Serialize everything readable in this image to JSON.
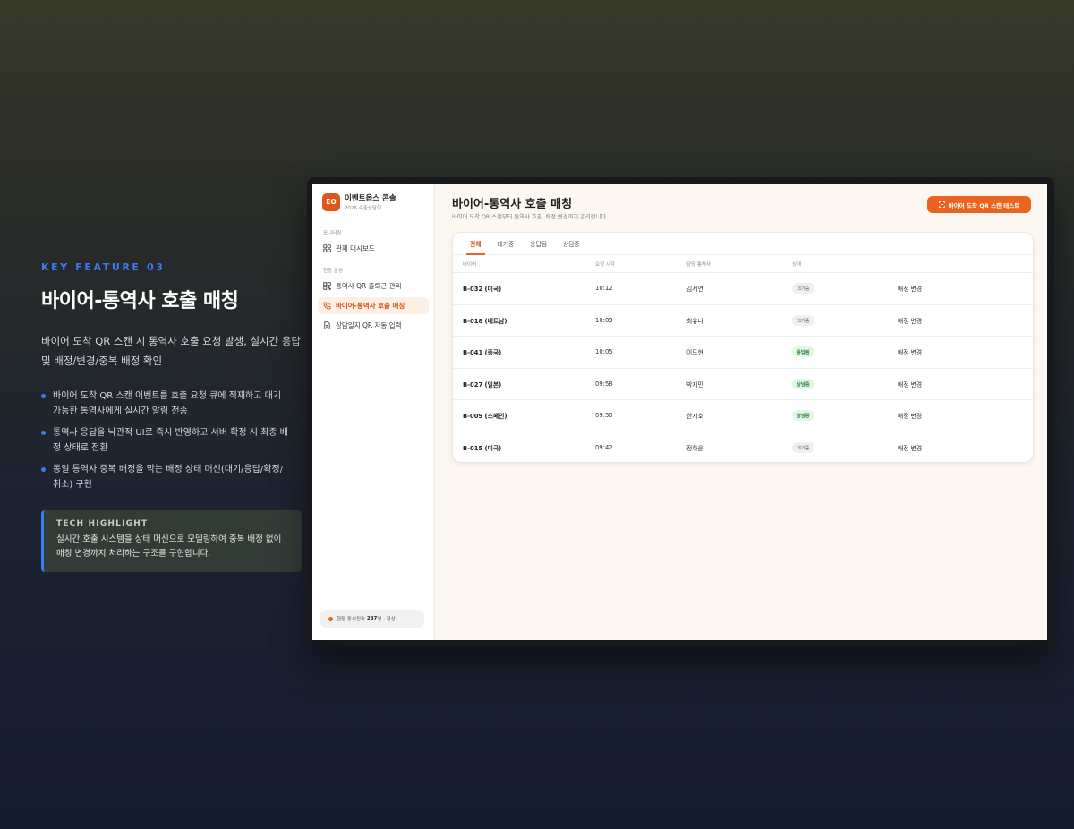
{
  "feature": {
    "eyebrow": "KEY FEATURE 03",
    "title": "바이어-통역사 호출 매칭",
    "description": "바이어 도착 QR 스캔 시 통역사 호출 요청 발생, 실시간 응답 및 배정/변경/중복 배정 확인",
    "bullets": [
      "바이어 도착 QR 스캔 이벤트를 호출 요청 큐에 적재하고 대기 가능한 통역사에게 실시간 알림 전송",
      "통역사 응답을 낙관적 UI로 즉시 반영하고 서버 확정 시 최종 배정 상태로 전환",
      "동일 통역사 중복 배정을 막는 배정 상태 머신(대기/응답/확정/취소) 구현"
    ],
    "tech_title": "TECH HIGHLIGHT",
    "tech_text": "실시간 호출 시스템을 상태 머신으로 모델링하여 중복 배정 없이 매칭 변경까지 처리하는 구조를 구현합니다."
  },
  "app": {
    "brand_logo": "EO",
    "brand_name": "이벤트옵스 콘솔",
    "brand_sub": "2026 수출상담회",
    "sidebar": {
      "section_monitoring": "모니터링",
      "section_ops": "현장 운영",
      "items": [
        {
          "label": "관제 대시보드",
          "icon": "grid-icon"
        },
        {
          "label": "통역사 QR 출퇴근 관리",
          "icon": "qr-icon"
        },
        {
          "label": "바이어-통역사 호출 매칭",
          "icon": "phone-icon"
        },
        {
          "label": "상담일지 QR 자동 입력",
          "icon": "document-icon"
        }
      ],
      "status_prefix": "현장 동시접속",
      "status_count": "287",
      "status_suffix": "명 · 정상"
    },
    "main": {
      "title": "바이어-통역사 호출 매칭",
      "subtitle": "바이어 도착 QR 스캔부터 통역사 호출, 배정 변경까지 관리합니다.",
      "cta_label": "바이어 도착 QR 스캔 테스트",
      "tabs": [
        "전체",
        "대기중",
        "응답됨",
        "상담중"
      ],
      "columns": [
        "바이어",
        "요청 시각",
        "담당 통역사",
        "상태"
      ],
      "action_label": "배정 변경",
      "rows": [
        {
          "buyer": "B-032 (미국)",
          "time": "10:12",
          "interpreter": "김서연",
          "status": "대기중"
        },
        {
          "buyer": "B-018 (베트남)",
          "time": "10:09",
          "interpreter": "최유나",
          "status": "대기중"
        },
        {
          "buyer": "B-041 (중국)",
          "time": "10:05",
          "interpreter": "이도현",
          "status": "응답됨"
        },
        {
          "buyer": "B-027 (일본)",
          "time": "09:58",
          "interpreter": "박지민",
          "status": "상담중"
        },
        {
          "buyer": "B-009 (스페인)",
          "time": "09:50",
          "interpreter": "한지호",
          "status": "상담중"
        },
        {
          "buyer": "B-015 (미국)",
          "time": "09:42",
          "interpreter": "정하윤",
          "status": "대기중"
        }
      ]
    }
  },
  "colors": {
    "accent": "#e8641f",
    "feature_blue": "#3d7bf0",
    "badge_green": "#2c8a3c"
  }
}
